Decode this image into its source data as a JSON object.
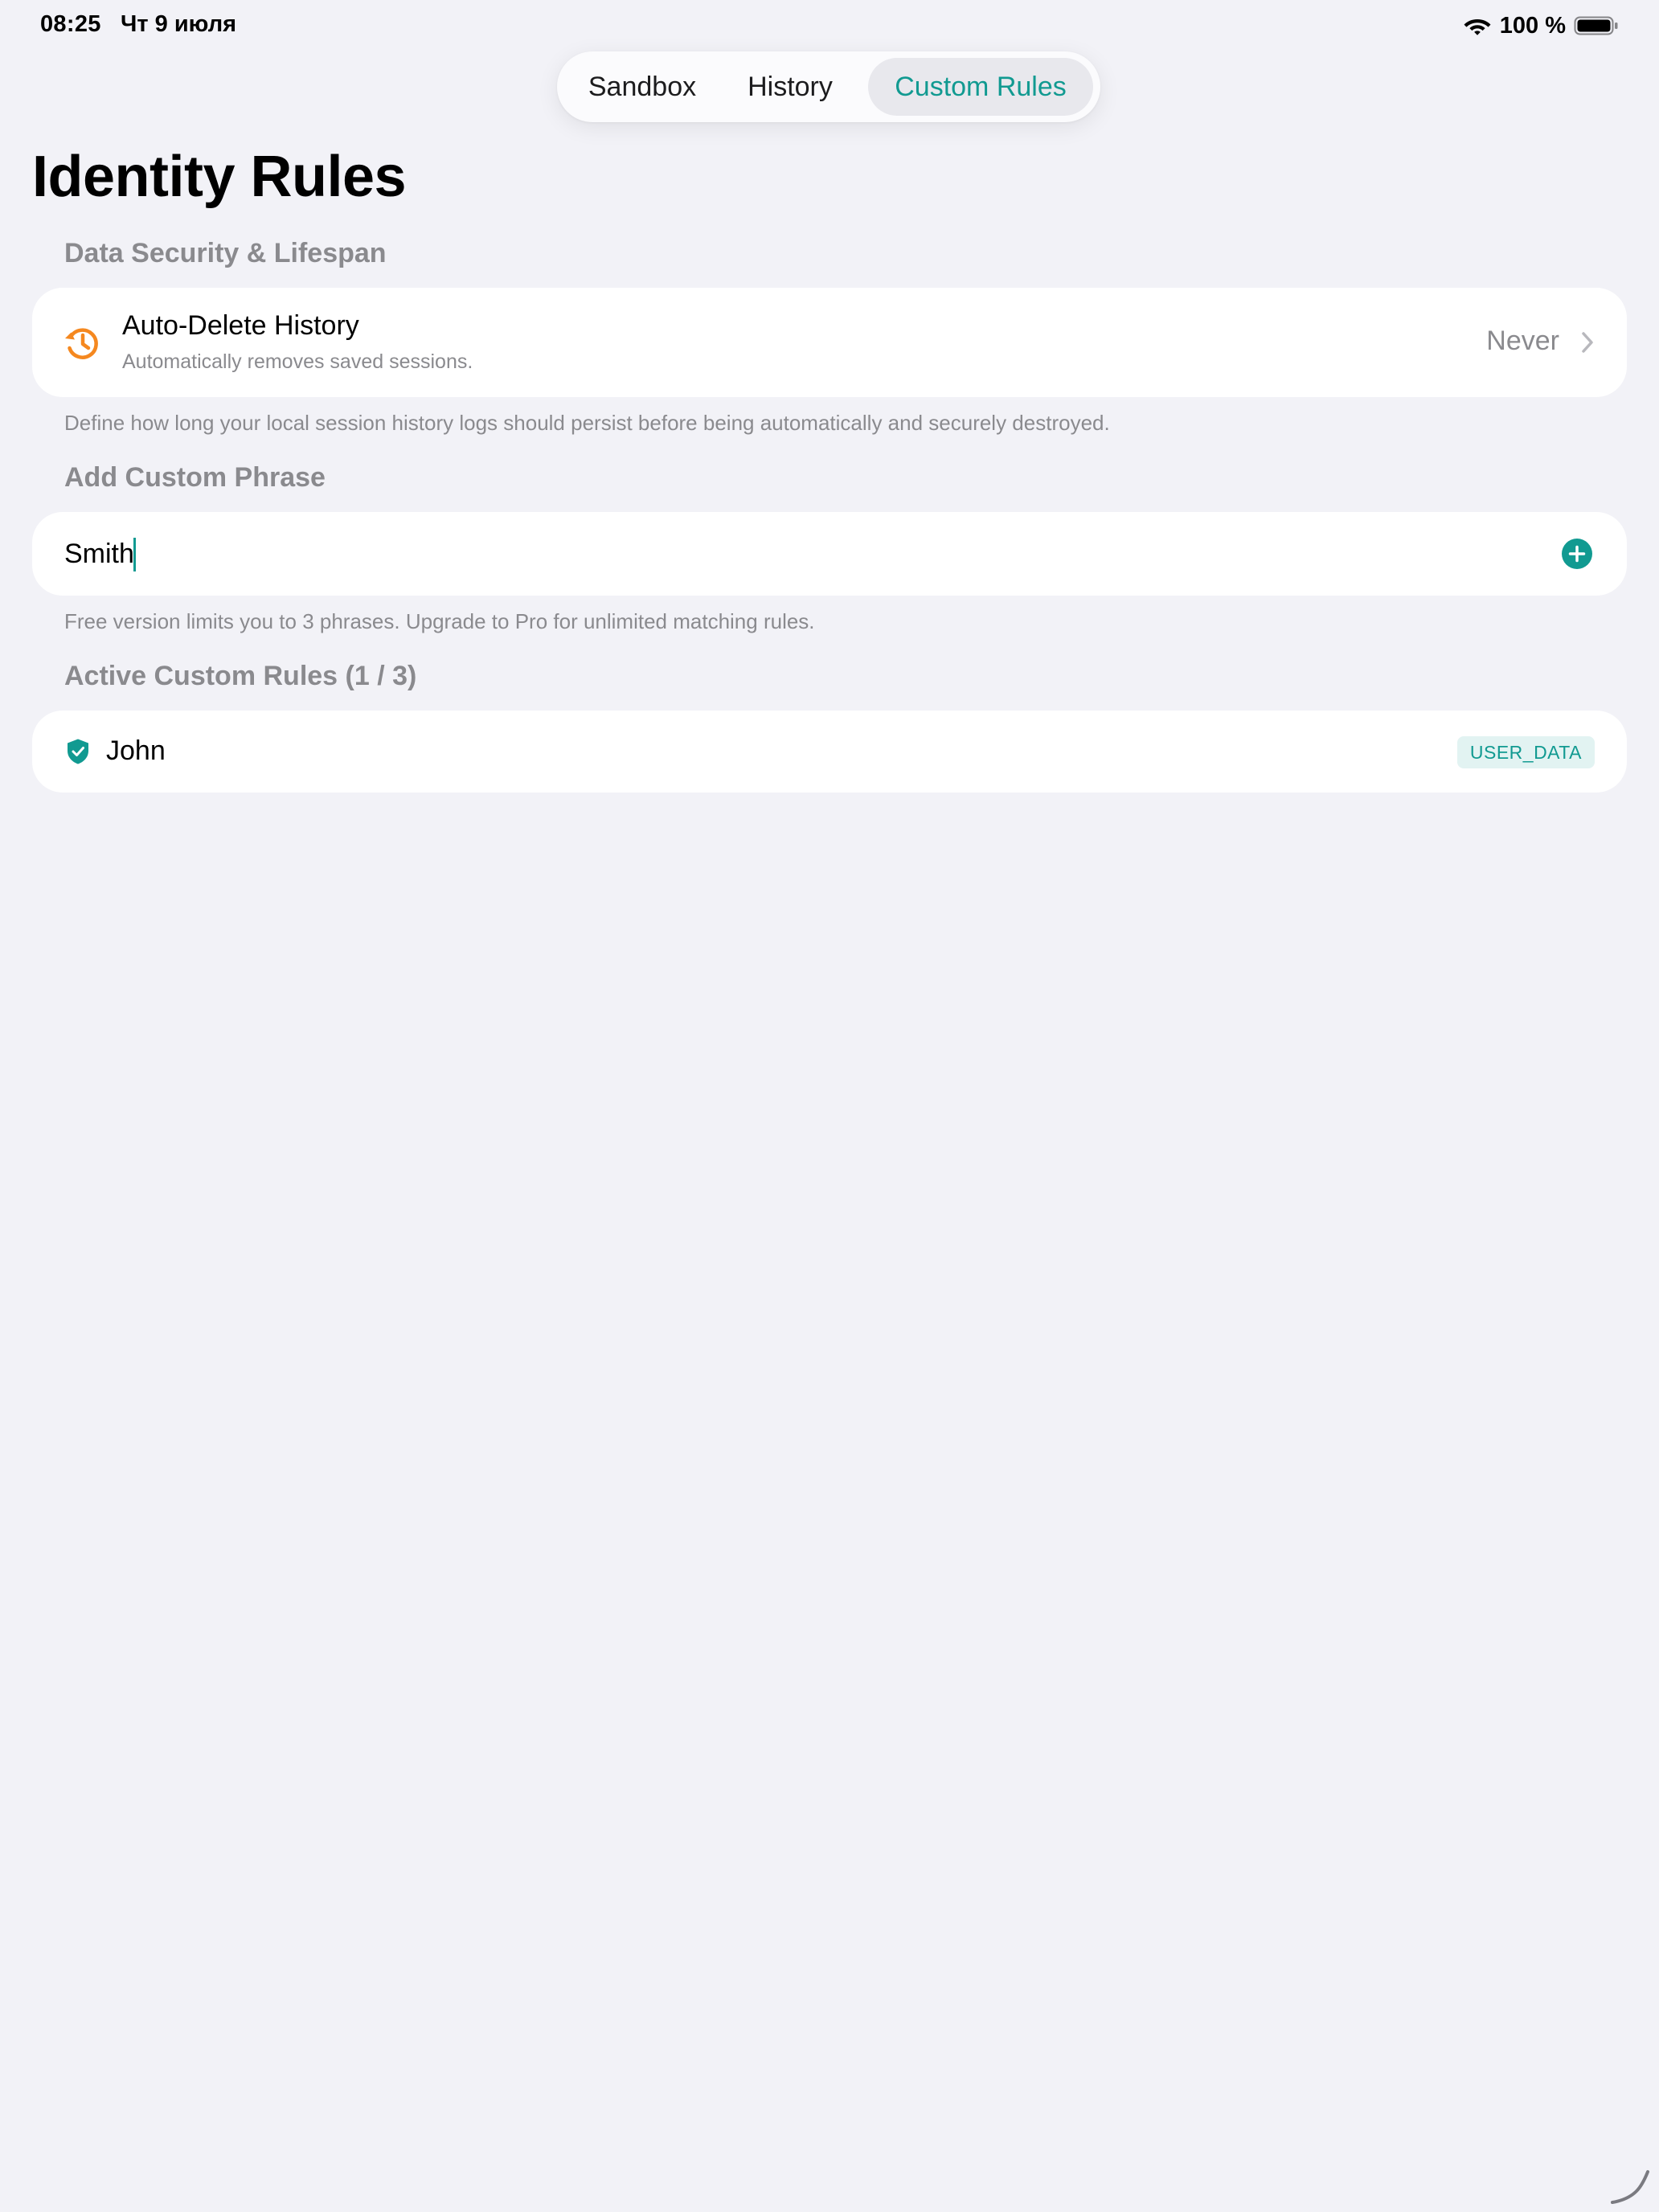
{
  "status_bar": {
    "time": "08:25",
    "date": "Чт 9 июля",
    "battery": "100 %",
    "icons": [
      "wifi-icon",
      "battery-icon"
    ]
  },
  "tabs": [
    {
      "label": "Sandbox",
      "selected": false
    },
    {
      "label": "History",
      "selected": false
    },
    {
      "label": "Custom Rules",
      "selected": true
    }
  ],
  "page": {
    "title": "Identity Rules"
  },
  "data_security": {
    "header": "Data Security & Lifespan",
    "row": {
      "icon": "clock-history-icon",
      "title": "Auto-Delete History",
      "subtitle": "Automatically removes saved sessions.",
      "value": "Never"
    },
    "footnote": "Define how long your local session history logs should persist before being automatically and securely destroyed."
  },
  "custom_phrase": {
    "header": "Add Custom Phrase",
    "input_value": "Smith",
    "add_icon": "plus-circle-icon",
    "footnote": "Free version limits you to 3 phrases. Upgrade to Pro for unlimited matching rules."
  },
  "active_rules": {
    "header": "Active Custom Rules (1 / 3)",
    "items": [
      {
        "text": "John",
        "badge": "USER_DATA",
        "icon": "shield-check-icon"
      }
    ]
  },
  "colors": {
    "accent": "#119a91",
    "orange": "#f5881f",
    "background": "#f2f2f7",
    "secondary_text": "#8a8a8e"
  }
}
